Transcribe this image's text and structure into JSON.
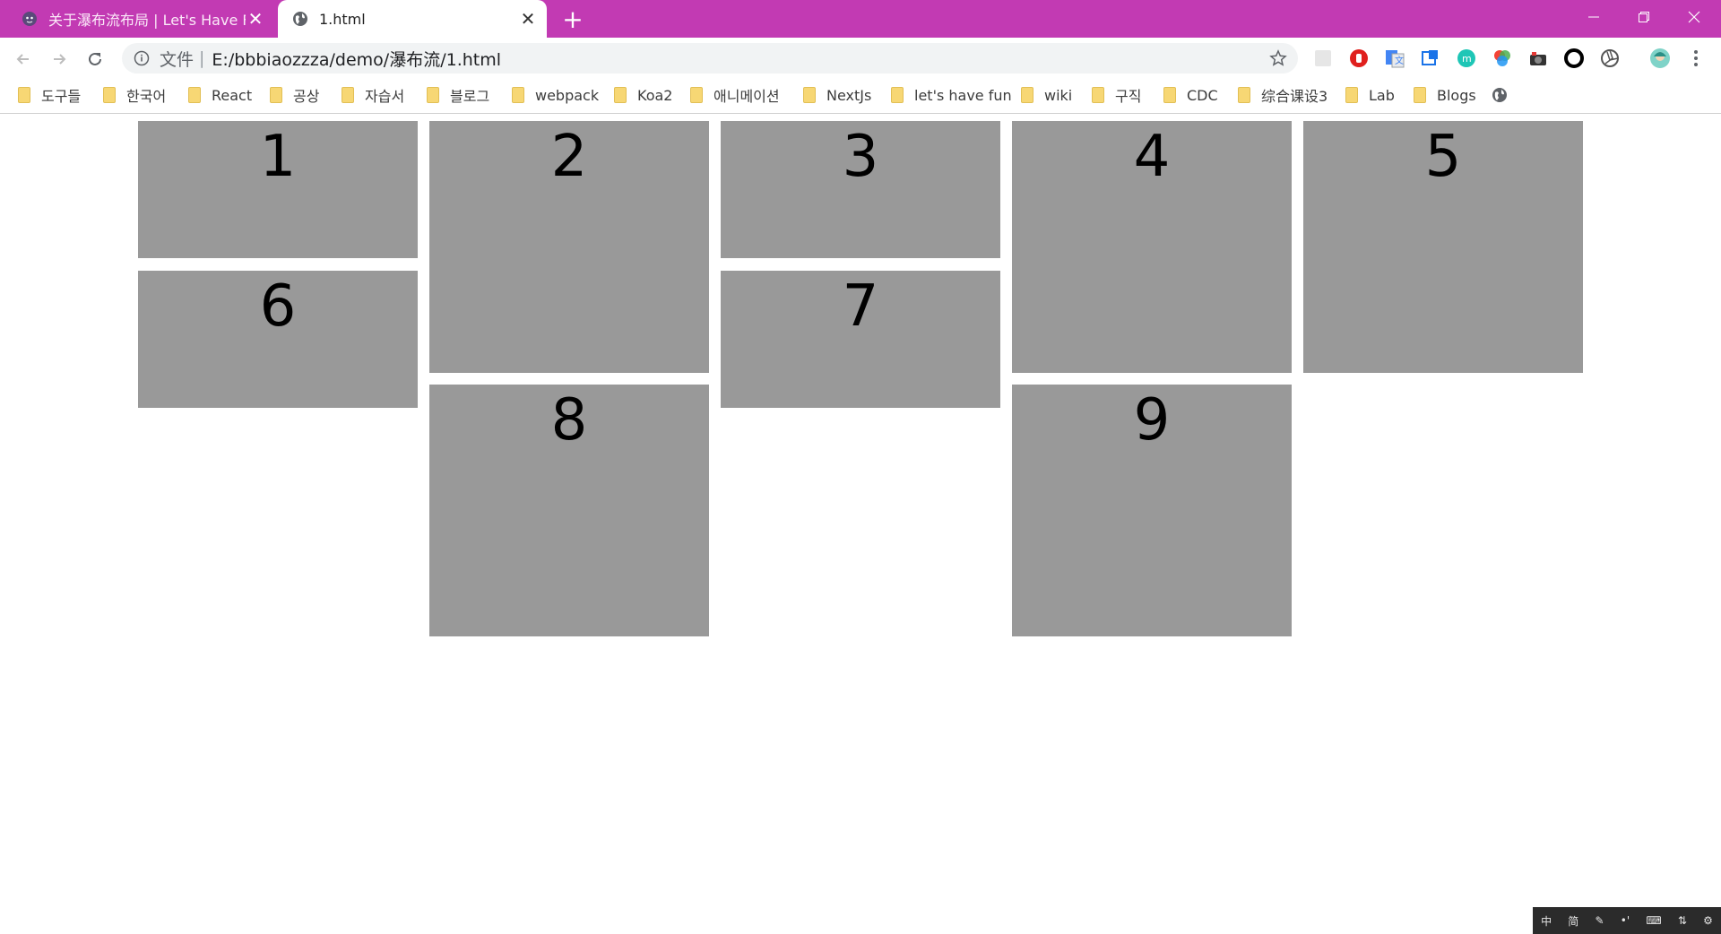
{
  "tabs": [
    {
      "title": "关于瀑布流布局 | Let's Have Fun",
      "active": false
    },
    {
      "title": "1.html",
      "active": true
    }
  ],
  "toolbar": {
    "scheme_label": "文件",
    "separator": "|",
    "url": "E:/bbbiaozzza/demo/瀑布流/1.html"
  },
  "bookmarks": [
    {
      "label": "도구들"
    },
    {
      "label": "한국어"
    },
    {
      "label": "React"
    },
    {
      "label": "공상"
    },
    {
      "label": "자습서"
    },
    {
      "label": "블로그"
    },
    {
      "label": "webpack"
    },
    {
      "label": "Koa2"
    },
    {
      "label": "애니메이션"
    },
    {
      "label": "NextJs"
    },
    {
      "label": "let's have fun"
    },
    {
      "label": "wiki"
    },
    {
      "label": "구직"
    },
    {
      "label": "CDC"
    },
    {
      "label": "综合课设3"
    },
    {
      "label": "Lab"
    },
    {
      "label": "Blogs"
    }
  ],
  "waterfall": {
    "items": [
      {
        "label": "1"
      },
      {
        "label": "2"
      },
      {
        "label": "3"
      },
      {
        "label": "4"
      },
      {
        "label": "5"
      },
      {
        "label": "6"
      },
      {
        "label": "7"
      },
      {
        "label": "8"
      },
      {
        "label": "9"
      }
    ]
  },
  "ime": {
    "items": [
      "中",
      "简",
      "✎",
      "•'",
      "⌨",
      "⇅",
      "⚙"
    ]
  },
  "colors": {
    "tabstrip": "#c23ab3",
    "box": "#999999"
  }
}
